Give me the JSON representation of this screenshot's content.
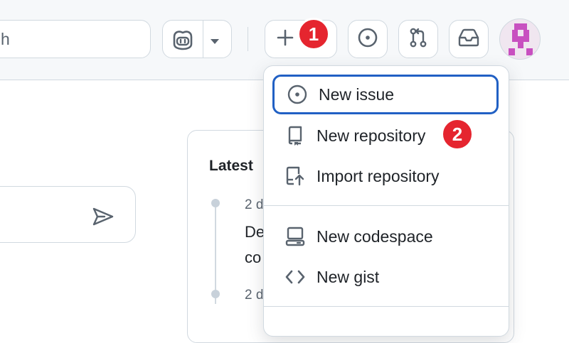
{
  "header": {
    "search_text": "h"
  },
  "badges": {
    "first": "1",
    "second": "2"
  },
  "dropdown": {
    "items": [
      {
        "label": "New issue",
        "icon": "issue-opened-icon"
      },
      {
        "label": "New repository",
        "icon": "repo-icon"
      },
      {
        "label": "Import repository",
        "icon": "repo-push-icon"
      },
      {
        "label": "New codespace",
        "icon": "codespaces-icon"
      },
      {
        "label": "New gist",
        "icon": "code-icon"
      }
    ]
  },
  "latest": {
    "title": "Latest",
    "entries": [
      {
        "meta": "2 d",
        "line1": "De",
        "line2": "co"
      },
      {
        "meta": "2 d"
      }
    ]
  },
  "colors": {
    "accent_outline": "#2160c4",
    "badge_red": "#e5252f",
    "border": "#d1d9e0",
    "header_bg": "#f6f8fa"
  }
}
